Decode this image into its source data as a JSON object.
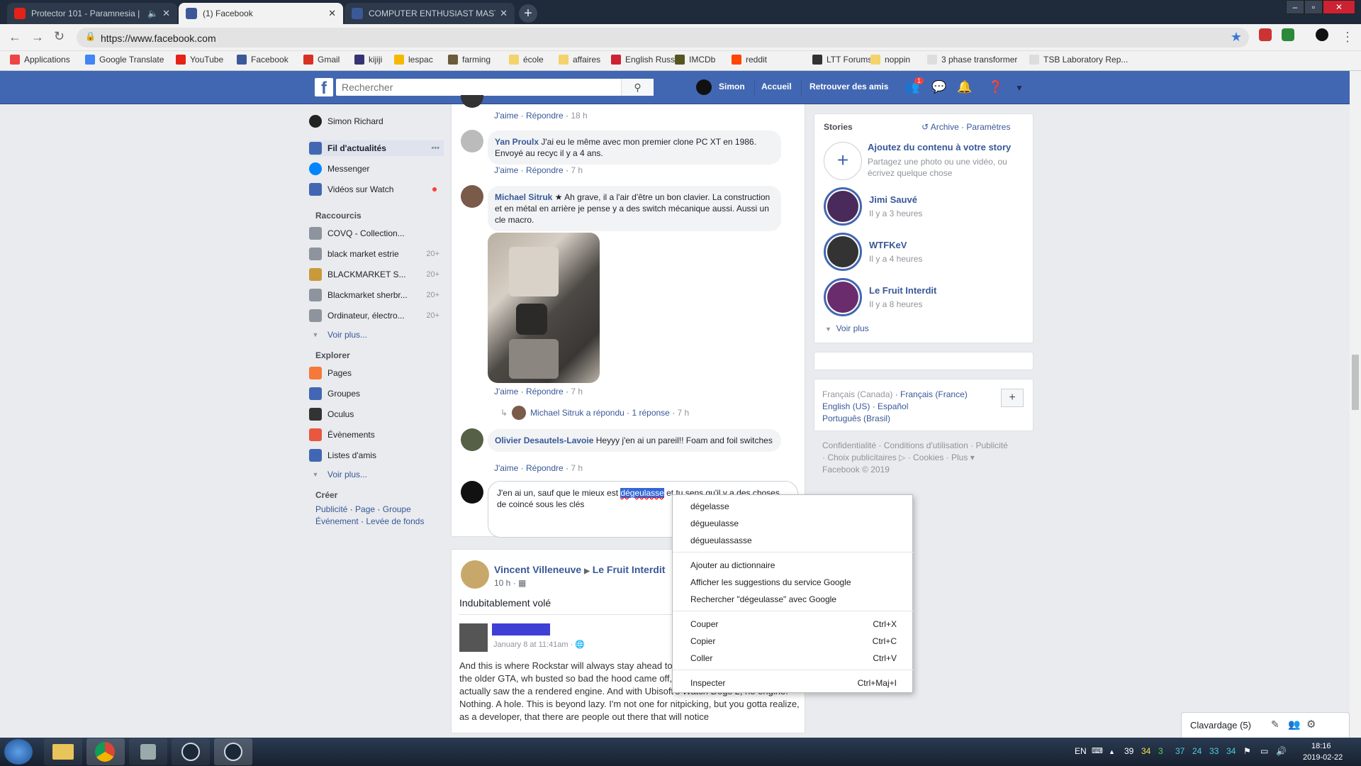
{
  "browser": {
    "tabs": [
      {
        "title": "Protector 101 - Paramnesia |",
        "active": false,
        "color": "#e62117"
      },
      {
        "title": "(1) Facebook",
        "active": true,
        "color": "#3b5998"
      },
      {
        "title": "COMPUTER ENTHUSIAST MASTE",
        "active": false,
        "color": "#3b5998"
      }
    ],
    "url": "https://www.facebook.com",
    "bookmarks": [
      {
        "label": "Applications",
        "color": "#e44"
      },
      {
        "label": "Google Translate",
        "color": "#4285f4"
      },
      {
        "label": "YouTube",
        "color": "#e62117"
      },
      {
        "label": "Facebook",
        "color": "#3b5998"
      },
      {
        "label": "Gmail",
        "color": "#d93025"
      },
      {
        "label": "kijiji",
        "color": "#373373"
      },
      {
        "label": "lespac",
        "color": "#f5b800"
      },
      {
        "label": "farming",
        "color": "#6b5b3a"
      },
      {
        "label": "école",
        "color": "#f4d36b"
      },
      {
        "label": "affaires",
        "color": "#f4d36b"
      },
      {
        "label": "English Russia",
        "color": "#c23"
      },
      {
        "label": "IMCDb",
        "color": "#552"
      },
      {
        "label": "reddit",
        "color": "#ff4500"
      },
      {
        "label": "LTT Forums",
        "color": "#333"
      },
      {
        "label": "noppin",
        "color": "#f4d36b"
      },
      {
        "label": "3 phase transformer",
        "color": "#ddd"
      },
      {
        "label": "TSB Laboratory Rep...",
        "color": "#ddd"
      }
    ]
  },
  "fb": {
    "search_placeholder": "Rechercher",
    "user": "Simon",
    "home": "Accueil",
    "find_friends": "Retrouver des amis",
    "notif_count": "1",
    "brand_color": "#4267b2"
  },
  "leftnav": {
    "profile": "Simon Richard",
    "main": [
      {
        "label": "Fil d'actualités",
        "more": "•••"
      },
      {
        "label": "Messenger"
      },
      {
        "label": "Vidéos sur Watch"
      }
    ],
    "shortcuts_title": "Raccourcis",
    "shortcuts": [
      {
        "label": "COVQ - Collection...",
        "count": ""
      },
      {
        "label": "black market estrie",
        "count": "20+"
      },
      {
        "label": "BLACKMARKET S...",
        "count": "20+"
      },
      {
        "label": "Blackmarket sherbr...",
        "count": "20+"
      },
      {
        "label": "Ordinateur, électro...",
        "count": "20+"
      }
    ],
    "see_more": "Voir plus...",
    "explore_title": "Explorer",
    "explore": [
      {
        "label": "Pages"
      },
      {
        "label": "Groupes"
      },
      {
        "label": "Oculus"
      },
      {
        "label": "Évènements"
      },
      {
        "label": "Listes d'amis"
      }
    ],
    "see_more2": "Voir plus...",
    "create_title": "Créer",
    "create1": [
      "Publicité",
      "Page",
      "Groupe"
    ],
    "create2": [
      "Événement",
      "Levée de fonds"
    ]
  },
  "comments": [
    {
      "meta_like": "J'aime",
      "meta_reply": "Répondre",
      "time": "18 h"
    },
    {
      "author": "Yan Proulx",
      "text": "J'ai eu le même avec mon premier clone PC XT en 1986. Envoyé au recyc il y a 4 ans.",
      "like": "J'aime",
      "reply": "Répondre",
      "time": "7 h"
    },
    {
      "author": "Michael Sitruk",
      "text": "Ah grave, il a l'air d'être un bon clavier. La construction et en métal en arrière je pense y a des switch mécanique aussi. Aussi un cle macro.",
      "like": "J'aime",
      "reply": "Répondre",
      "time": "7 h",
      "reply_summary": "Michael Sitruk a répondu",
      "reply_count": "1 réponse",
      "reply_time": "7 h"
    },
    {
      "author": "Olivier Desautels-Lavoie",
      "text": "Heyyy j'en ai un pareil!! Foam and foil switches",
      "like": "J'aime",
      "reply": "Répondre",
      "time": "7 h"
    }
  ],
  "compose": {
    "before": "J'en ai un, sauf que le mieux est ",
    "selected": "dégeulasse",
    "after": " et tu sens qu'il y a des choses de coincé sous les clés"
  },
  "post2": {
    "author": "Vincent Villeneuve",
    "target": "Le Fruit Interdit",
    "time": "10 h",
    "text": "Indubitablement volé",
    "shared_date": "January 8 at 11:41am",
    "shared_text": "And this is where Rockstar will always stay ahead to open world details. Even in the older GTA, wh busted so bad the hood came off, there'd be an engine. You actually saw the a rendered engine. And with Ubisoft's Watch Dogs 2, no engine. Nothing. A hole. This is beyond lazy. I'm not one for nitpicking, but you gotta realize, as a developer, that there are people out there that will notice"
  },
  "stories": {
    "title": "Stories",
    "archive": "Archive",
    "settings": "Paramètres",
    "add_title": "Ajoutez du contenu à votre story",
    "add_sub": "Partagez une photo ou une vidéo, ou écrivez quelque chose",
    "items": [
      {
        "name": "Jimi Sauvé",
        "time": "Il y a 3 heures",
        "color": "#4a2a5a"
      },
      {
        "name": "WTFKeV",
        "time": "Il y a 4 heures",
        "color": "#333"
      },
      {
        "name": "Le Fruit Interdit",
        "time": "Il y a 8 heures",
        "color": "#6a2c6c"
      }
    ],
    "see_more": "Voir plus"
  },
  "languages": {
    "current": "Français (Canada)",
    "others": [
      "Français (France)",
      "English (US)",
      "Español",
      "Português (Brasil)"
    ]
  },
  "footer": {
    "links": [
      "Confidentialité",
      "Conditions d'utilisation",
      "Publicité",
      "Choix publicitaires",
      "Cookies",
      "Plus"
    ],
    "copyright": "Facebook © 2019"
  },
  "context_menu": {
    "suggestions": [
      "dégelasse",
      "dégueulasse",
      "dégueulassasse"
    ],
    "add_dict": "Ajouter au dictionnaire",
    "google_suggest": "Afficher les suggestions du service Google",
    "search": "Rechercher \"dégeulasse\" avec Google",
    "cut": "Couper",
    "cut_k": "Ctrl+X",
    "copy": "Copier",
    "copy_k": "Ctrl+C",
    "paste": "Coller",
    "paste_k": "Ctrl+V",
    "inspect": "Inspecter",
    "inspect_k": "Ctrl+Maj+I"
  },
  "chat": {
    "label": "Clavardage (5)"
  },
  "taskbar": {
    "lang": "EN",
    "numbers": [
      "39",
      "34",
      "3",
      "37",
      "24",
      "33",
      "34"
    ],
    "time": "18:16",
    "date": "2019-02-22"
  }
}
